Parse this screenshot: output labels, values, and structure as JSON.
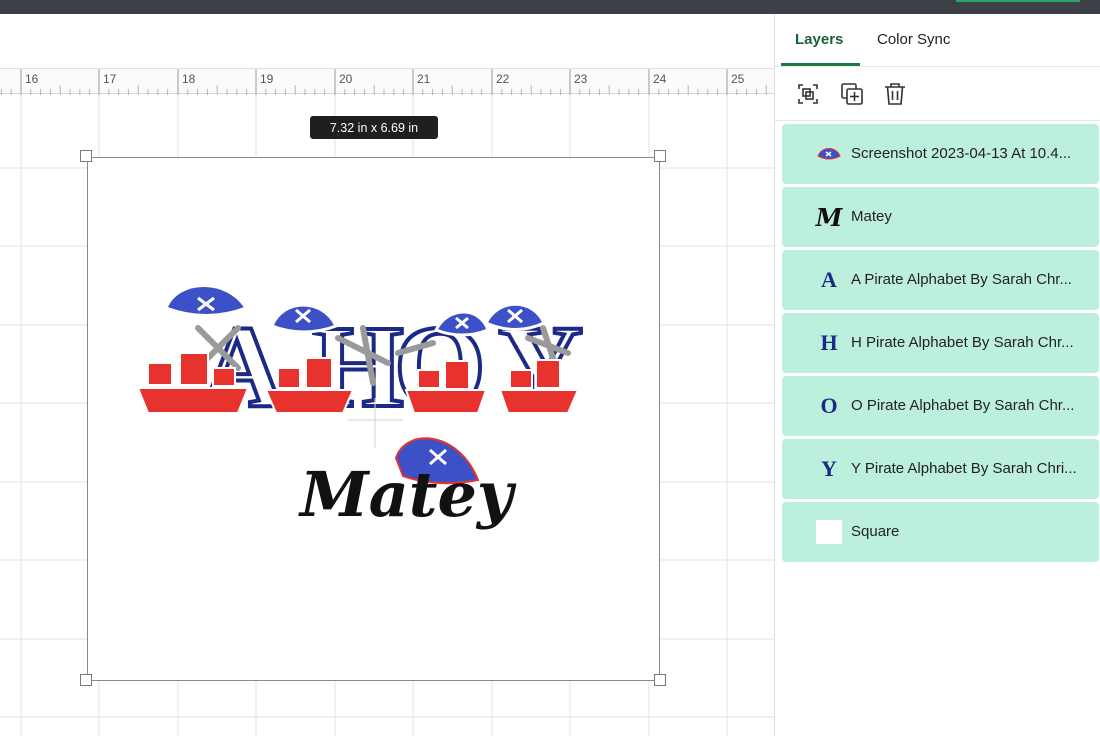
{
  "canvas": {
    "ruler_numbers": [
      "16",
      "17",
      "18",
      "19",
      "20",
      "21",
      "22",
      "23",
      "24",
      "25"
    ],
    "size_label": "7.32  in x 6.69  in",
    "artwork": {
      "main_word": "AHOY",
      "sub_word": "Matey"
    }
  },
  "panel": {
    "tabs": [
      {
        "label": "Layers",
        "active": true
      },
      {
        "label": "Color Sync",
        "active": false
      }
    ],
    "toolbar": {
      "group_icon": "group-icon",
      "duplicate_icon": "duplicate-icon",
      "delete_icon": "trash-icon"
    },
    "layers": [
      {
        "name": "Screenshot 2023-04-13 At 10.4...",
        "thumb": "pirate-hat-thumb"
      },
      {
        "name": "Matey",
        "thumb": "script-m-thumb",
        "glyph": "M"
      },
      {
        "name": "A Pirate Alphabet By Sarah Chr...",
        "thumb": "letter-a-thumb",
        "glyph": "A"
      },
      {
        "name": "H Pirate Alphabet By Sarah Chr...",
        "thumb": "letter-h-thumb",
        "glyph": "H"
      },
      {
        "name": "O Pirate Alphabet By Sarah Chr...",
        "thumb": "letter-o-thumb",
        "glyph": "O"
      },
      {
        "name": "Y Pirate Alphabet By Sarah Chri...",
        "thumb": "letter-y-thumb",
        "glyph": "Y"
      },
      {
        "name": "Square",
        "thumb": "white-square-thumb"
      }
    ]
  },
  "colors": {
    "accent_green": "#1d7a44",
    "layer_bg": "#bdefdd",
    "navy": "#1c2a86",
    "red": "#e8322e",
    "hat_blue": "#3c50c8"
  }
}
